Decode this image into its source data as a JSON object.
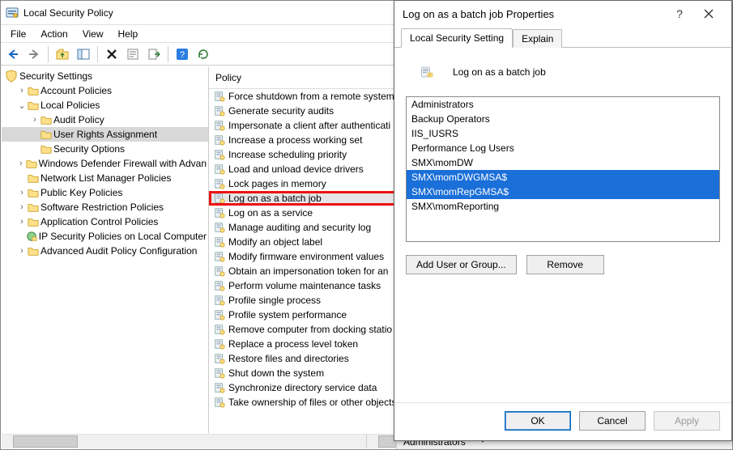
{
  "window": {
    "title": "Local Security Policy"
  },
  "menubar": {
    "items": [
      "File",
      "Action",
      "View",
      "Help"
    ]
  },
  "tree": {
    "root": "Security Settings",
    "nodes": [
      {
        "label": "Account Policies",
        "depth": 1,
        "expander": ">",
        "icon": "folder"
      },
      {
        "label": "Local Policies",
        "depth": 1,
        "expander": "v",
        "icon": "folder"
      },
      {
        "label": "Audit Policy",
        "depth": 2,
        "expander": ">",
        "icon": "folder"
      },
      {
        "label": "User Rights Assignment",
        "depth": 2,
        "expander": "",
        "icon": "folder",
        "selected": true
      },
      {
        "label": "Security Options",
        "depth": 2,
        "expander": "",
        "icon": "folder"
      },
      {
        "label": "Windows Defender Firewall with Advan",
        "depth": 1,
        "expander": ">",
        "icon": "folder"
      },
      {
        "label": "Network List Manager Policies",
        "depth": 1,
        "expander": "",
        "icon": "folder"
      },
      {
        "label": "Public Key Policies",
        "depth": 1,
        "expander": ">",
        "icon": "folder"
      },
      {
        "label": "Software Restriction Policies",
        "depth": 1,
        "expander": ">",
        "icon": "folder"
      },
      {
        "label": "Application Control Policies",
        "depth": 1,
        "expander": ">",
        "icon": "folder"
      },
      {
        "label": "IP Security Policies on Local Computer",
        "depth": 1,
        "expander": "",
        "icon": "ipsec"
      },
      {
        "label": "Advanced Audit Policy Configuration",
        "depth": 1,
        "expander": ">",
        "icon": "folder"
      }
    ]
  },
  "list": {
    "header": "Policy",
    "header_second": "Administrators",
    "items": [
      {
        "label": "Force shutdown from a remote system"
      },
      {
        "label": "Generate security audits"
      },
      {
        "label": "Impersonate a client after authenticati"
      },
      {
        "label": "Increase a process working set"
      },
      {
        "label": "Increase scheduling priority"
      },
      {
        "label": "Load and unload device drivers"
      },
      {
        "label": "Lock pages in memory"
      },
      {
        "label": "Log on as a batch job",
        "selected": true,
        "highlighted": true
      },
      {
        "label": "Log on as a service"
      },
      {
        "label": "Manage auditing and security log"
      },
      {
        "label": "Modify an object label"
      },
      {
        "label": "Modify firmware environment values"
      },
      {
        "label": "Obtain an impersonation token for an"
      },
      {
        "label": "Perform volume maintenance tasks"
      },
      {
        "label": "Profile single process"
      },
      {
        "label": "Profile system performance"
      },
      {
        "label": "Remove computer from docking statio"
      },
      {
        "label": "Replace a process level token"
      },
      {
        "label": "Restore files and directories"
      },
      {
        "label": "Shut down the system"
      },
      {
        "label": "Synchronize directory service data"
      },
      {
        "label": "Take ownership of files or other objects"
      }
    ]
  },
  "dialog": {
    "title": "Log on as a batch job Properties",
    "tabs": [
      "Local Security Setting",
      "Explain"
    ],
    "active_tab": 0,
    "heading": "Log on as a batch job",
    "principals": [
      {
        "name": "Administrators",
        "selected": false
      },
      {
        "name": "Backup Operators",
        "selected": false
      },
      {
        "name": "IIS_IUSRS",
        "selected": false
      },
      {
        "name": "Performance Log Users",
        "selected": false
      },
      {
        "name": "SMX\\momDW",
        "selected": false
      },
      {
        "name": "SMX\\momDWGMSA$",
        "selected": true
      },
      {
        "name": "SMX\\momRepGMSA$",
        "selected": true
      },
      {
        "name": "SMX\\momReporting",
        "selected": false
      }
    ],
    "buttons": {
      "add": "Add User or Group...",
      "remove": "Remove",
      "ok": "OK",
      "cancel": "Cancel",
      "apply": "Apply"
    }
  }
}
